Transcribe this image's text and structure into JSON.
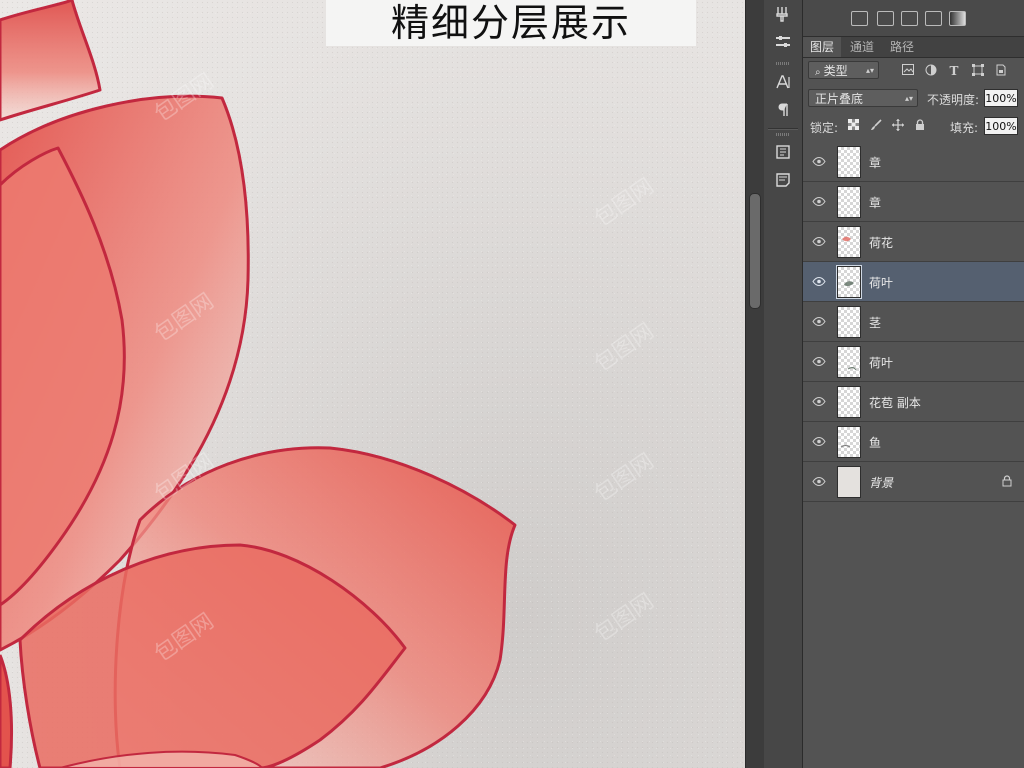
{
  "canvas": {
    "title": "精细分层展示",
    "watermarks": [
      "包图网",
      "包图网",
      "包图网",
      "包图网",
      "包图网",
      "包图网",
      "包图网",
      "包图网"
    ]
  },
  "toolstrip": {
    "icons": [
      "brush-preset-icon",
      "tool-preset-icon",
      "character-icon",
      "paragraph-icon",
      "character-styles-icon",
      "paragraph-styles-icon"
    ]
  },
  "panel": {
    "tabs": [
      {
        "label": "图层",
        "active": true
      },
      {
        "label": "通道",
        "active": false
      },
      {
        "label": "路径",
        "active": false
      }
    ],
    "filter_kind": "类型",
    "blend_mode": "正片叠底",
    "opacity_label": "不透明度:",
    "opacity_value": "100%",
    "lock_label": "锁定:",
    "fill_label": "填充:",
    "fill_value": "100%",
    "layers": [
      {
        "name": "章",
        "selected": false,
        "locked": false
      },
      {
        "name": "章",
        "selected": false,
        "locked": false
      },
      {
        "name": "荷花",
        "selected": false,
        "locked": false
      },
      {
        "name": "荷叶",
        "selected": true,
        "locked": false
      },
      {
        "name": "茎",
        "selected": false,
        "locked": false
      },
      {
        "name": "荷叶",
        "selected": false,
        "locked": false
      },
      {
        "name": "花苞 副本",
        "selected": false,
        "locked": false
      },
      {
        "name": "鱼",
        "selected": false,
        "locked": false
      },
      {
        "name": "背景",
        "selected": false,
        "locked": true
      }
    ]
  },
  "colors": {
    "petal_fill": "#ea6c62",
    "petal_edge": "#c2283f",
    "selected_row": "#556070"
  }
}
